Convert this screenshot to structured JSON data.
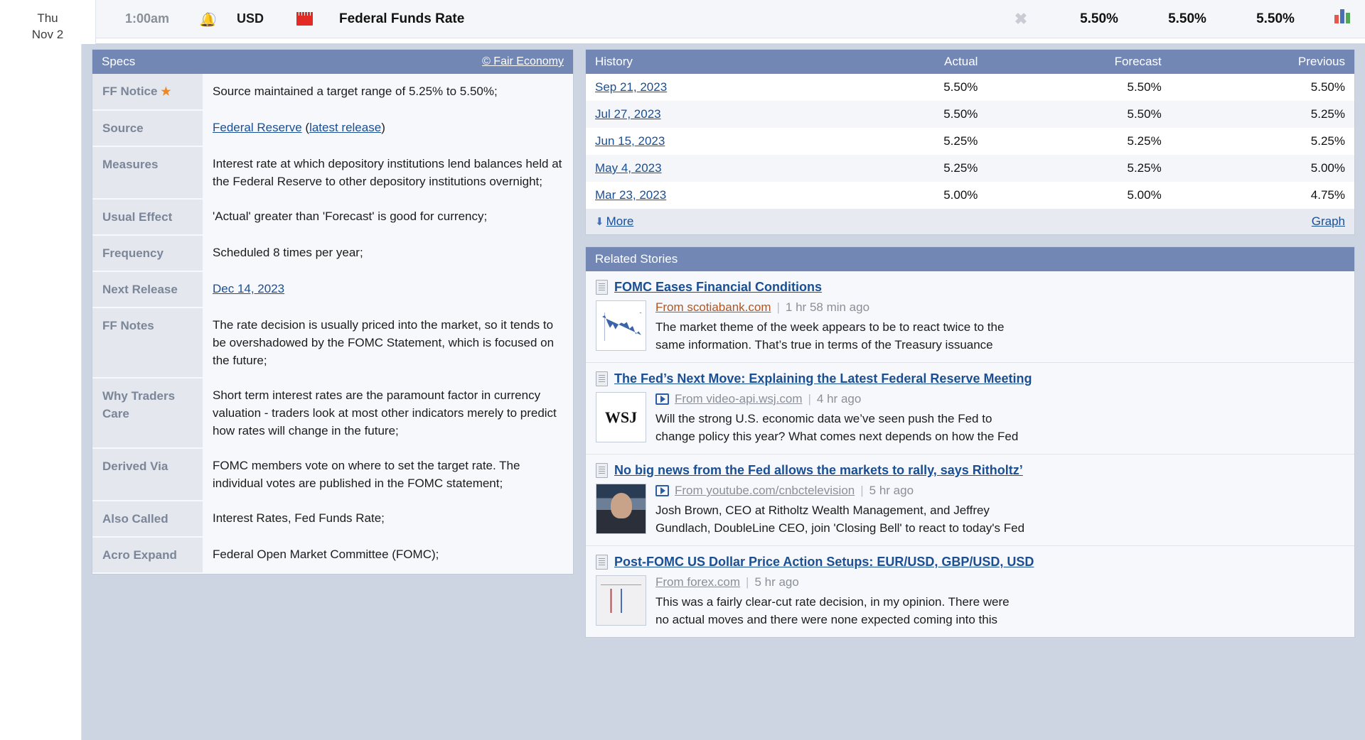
{
  "event": {
    "date_day": "Thu",
    "date_date": "Nov 2",
    "time": "1:00am",
    "alarm_icon": "alarm-bell-icon",
    "currency": "USD",
    "impact_icon": "red-folder-impact-icon",
    "title": "Federal Funds Rate",
    "detail_icon": "collapse-detail-icon",
    "actual": "5.50%",
    "forecast": "5.50%",
    "previous": "5.50%",
    "graph_icon": "bar-graph-icon"
  },
  "specs": {
    "header": "Specs",
    "copyright": "© Fair Economy",
    "rows": [
      {
        "key": "FF Notice",
        "star": "★",
        "value": "Source maintained a target range of 5.25% to 5.50%;"
      },
      {
        "key": "Source",
        "value_prefix": "",
        "link1": "Federal Reserve",
        "mid": " (",
        "link2": "latest release",
        "suffix": ")"
      },
      {
        "key": "Measures",
        "value": "Interest rate at which depository institutions lend balances held at the Federal Reserve to other depository institutions overnight;"
      },
      {
        "key": "Usual Effect",
        "value": "'Actual' greater than 'Forecast' is good for currency;"
      },
      {
        "key": "Frequency",
        "value": "Scheduled 8 times per year;"
      },
      {
        "key": "Next Release",
        "link1": "Dec 14, 2023"
      },
      {
        "key": "FF Notes",
        "value": "The rate decision is usually priced into the market, so it tends to be overshadowed by the FOMC Statement, which is focused on the future;"
      },
      {
        "key": "Why Traders Care",
        "value": "Short term interest rates are the paramount factor in currency valuation - traders look at most other indicators merely to predict how rates will change in the future;"
      },
      {
        "key": "Derived Via",
        "value": "FOMC members vote on where to set the target rate. The individual votes are published in the FOMC statement;"
      },
      {
        "key": "Also Called",
        "value": "Interest Rates, Fed Funds Rate;"
      },
      {
        "key": "Acro Expand",
        "value": "Federal Open Market Committee (FOMC);"
      }
    ]
  },
  "history": {
    "header": "History",
    "columns": [
      "Actual",
      "Forecast",
      "Previous"
    ],
    "rows": [
      {
        "date": "Sep 21, 2023",
        "actual": "5.50%",
        "forecast": "5.50%",
        "previous": "5.50%"
      },
      {
        "date": "Jul 27, 2023",
        "actual": "5.50%",
        "forecast": "5.50%",
        "previous": "5.25%"
      },
      {
        "date": "Jun 15, 2023",
        "actual": "5.25%",
        "forecast": "5.25%",
        "previous": "5.25%"
      },
      {
        "date": "May 4, 2023",
        "actual": "5.25%",
        "forecast": "5.25%",
        "previous": "5.00%"
      },
      {
        "date": "Mar 23, 2023",
        "actual": "5.00%",
        "forecast": "5.00%",
        "previous": "4.75%"
      }
    ],
    "more_label": "More",
    "graph_label": "Graph"
  },
  "related": {
    "header": "Related Stories",
    "stories": [
      {
        "title": "FOMC Eases Financial Conditions",
        "source": "From scotiabank.com",
        "has_video": false,
        "ago": "1 hr 58 min ago",
        "line1": "The market theme of the week appears to be to react twice to the",
        "line2": "same information. That’s true in terms of the Treasury issuance",
        "thumb": "line-chart-thumbnail"
      },
      {
        "title": "The Fed’s Next Move: Explaining the Latest Federal Reserve Meeting",
        "source": "From video-api.wsj.com",
        "has_video": true,
        "ago": "4 hr ago",
        "line1": "Will the strong U.S. economic data we’ve seen push the Fed to",
        "line2": "change policy this year? What comes next depends on how the Fed",
        "thumb": "wsj-logo-thumbnail"
      },
      {
        "title": "No big news from the Fed allows the markets to rally, says Ritholtz’",
        "source": "From youtube.com/cnbctelevision",
        "has_video": true,
        "ago": "5 hr ago",
        "line1": "Josh Brown, CEO at Ritholtz Wealth Management, and Jeffrey",
        "line2": "Gundlach, DoubleLine CEO, join 'Closing Bell' to react to today's Fed",
        "thumb": "person-video-thumbnail"
      },
      {
        "title": "Post-FOMC US Dollar Price Action Setups: EUR/USD, GBP/USD, USD",
        "source": "From forex.com",
        "has_video": false,
        "ago": "5 hr ago",
        "line1": "This was a fairly clear-cut rate decision, in my opinion. There were",
        "line2": "no actual moves and there were none expected coming into this",
        "thumb": "price-chart-thumbnail"
      }
    ]
  },
  "colors": {
    "panel_header": "#7387b4",
    "link": "#1a4f93",
    "impact_red": "#e32a24",
    "star_orange": "#f0861f",
    "page_bg": "#ced5e2"
  }
}
